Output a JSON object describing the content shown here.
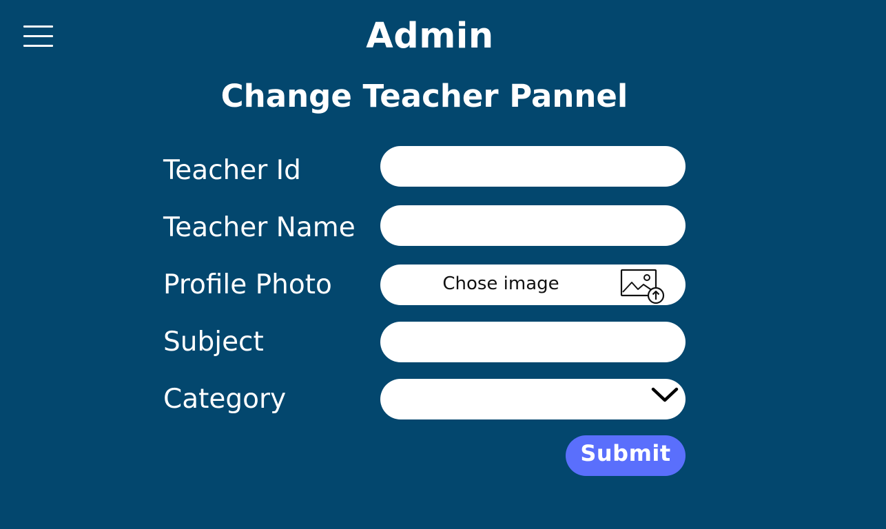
{
  "header": {
    "title": "Admin",
    "menu_icon": "hamburger-menu-icon"
  },
  "page": {
    "title": "Change Teacher Pannel"
  },
  "form": {
    "teacher_id": {
      "label": "Teacher Id",
      "value": "",
      "placeholder": ""
    },
    "teacher_name": {
      "label": "Teacher Name",
      "value": "",
      "placeholder": ""
    },
    "profile_photo": {
      "label": "Profile Photo",
      "button_text": "Chose image",
      "icon": "image-upload-icon"
    },
    "subject": {
      "label": "Subject",
      "value": "",
      "placeholder": ""
    },
    "category": {
      "label": "Category",
      "selected": "",
      "icon": "chevron-down-icon"
    },
    "submit_label": "Submit"
  },
  "colors": {
    "background": "#03476e",
    "field_background": "#ffffff",
    "submit_button": "#5a6ffc",
    "text": "#ffffff"
  }
}
